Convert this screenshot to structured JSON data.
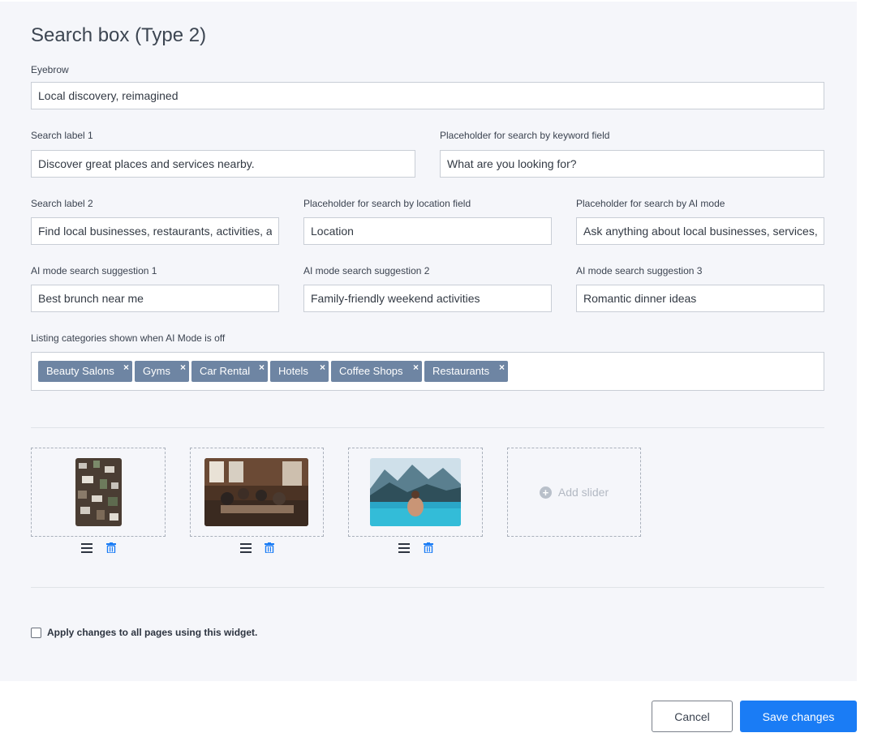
{
  "title": "Search box (Type 2)",
  "fields": {
    "eyebrow": {
      "label": "Eyebrow",
      "value": "Local discovery, reimagined"
    },
    "search_label_1": {
      "label": "Search label 1",
      "value": "Discover great places and services nearby."
    },
    "keyword_placeholder": {
      "label": "Placeholder for search by keyword field",
      "value": "What are you looking for?"
    },
    "search_label_2": {
      "label": "Search label 2",
      "value": "Find local businesses, restaurants, activities, a"
    },
    "location_placeholder": {
      "label": "Placeholder for search by location field",
      "value": "Location"
    },
    "ai_placeholder": {
      "label": "Placeholder for search by AI mode",
      "value": "Ask anything about local businesses, services,"
    },
    "ai_suggestion_1": {
      "label": "AI mode search suggestion 1",
      "value": "Best brunch near me"
    },
    "ai_suggestion_2": {
      "label": "AI mode search suggestion 2",
      "value": "Family-friendly weekend activities"
    },
    "ai_suggestion_3": {
      "label": "AI mode search suggestion 3",
      "value": "Romantic dinner ideas"
    }
  },
  "categories": {
    "label": "Listing categories shown when AI Mode is off",
    "tags": [
      "Beauty Salons",
      "Gyms",
      "Car Rental",
      "Hotels",
      "Coffee Shops",
      "Restaurants"
    ],
    "remove_glyph": "×"
  },
  "sliders": {
    "items": [
      {
        "image": "aerial-city-photo"
      },
      {
        "image": "meeting-room-photo"
      },
      {
        "image": "infinity-pool-photo"
      }
    ],
    "add_label": "Add slider"
  },
  "apply_all": {
    "label": "Apply changes to all pages using this widget.",
    "checked": false
  },
  "actions": {
    "cancel": "Cancel",
    "save": "Save changes"
  },
  "colors": {
    "accent": "#1a7cf5",
    "tag": "#6e85a3",
    "panel": "#f5f6fa"
  }
}
